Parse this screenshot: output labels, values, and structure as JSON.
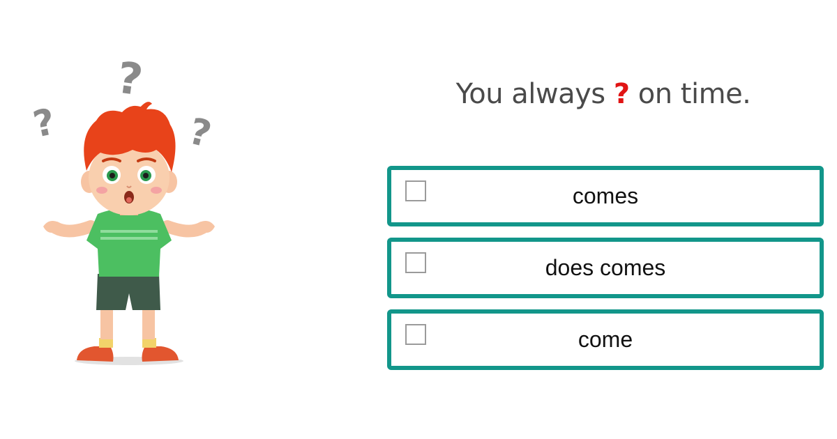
{
  "question": {
    "before": "You always",
    "blank": "?",
    "after": "on time."
  },
  "options": [
    {
      "label": "comes",
      "checked": false
    },
    {
      "label": "does comes",
      "checked": false
    },
    {
      "label": "come",
      "checked": false
    }
  ],
  "illustration": {
    "icon": "confused-boy-icon",
    "question_marks": [
      "?",
      "?",
      "?"
    ]
  },
  "colors": {
    "option_border": "#12968a",
    "blank": "#e11414",
    "question_text": "#4a4a4a"
  }
}
